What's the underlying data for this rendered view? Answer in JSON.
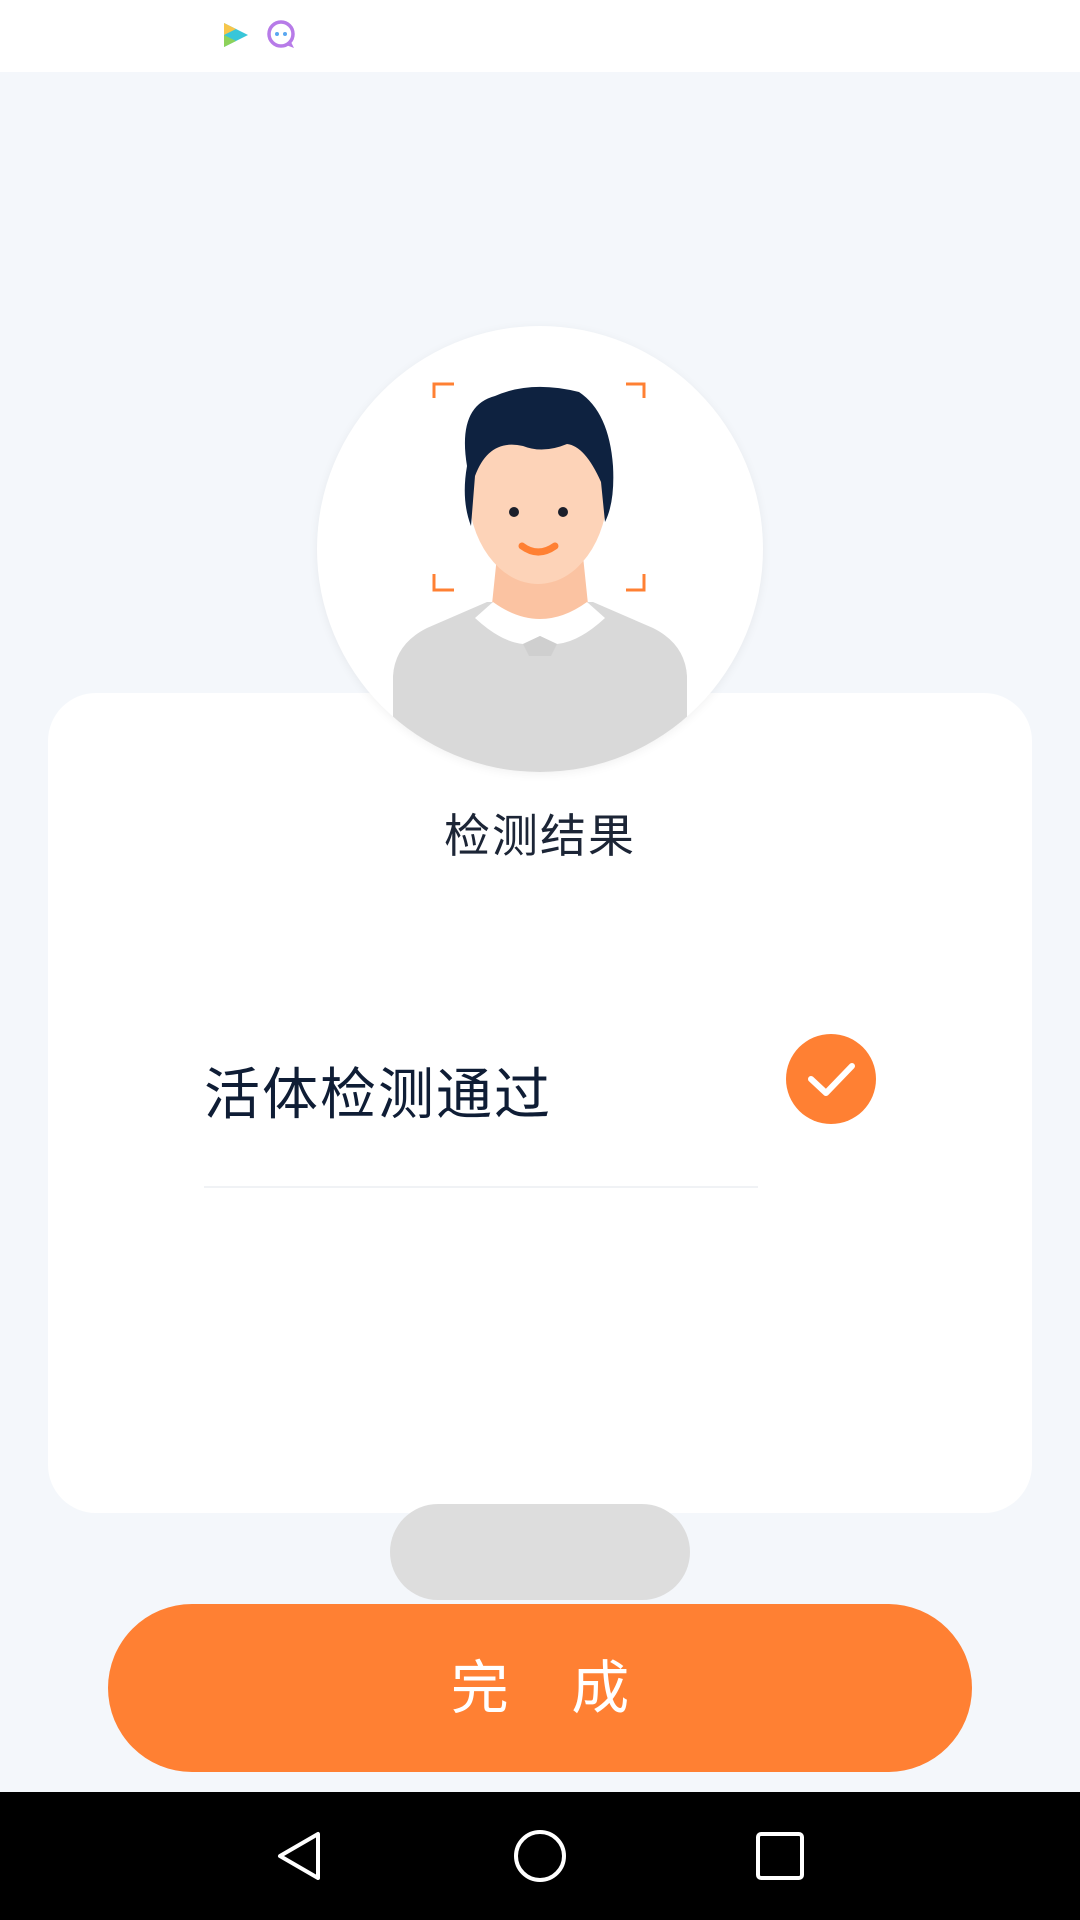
{
  "result": {
    "title": "检测结果",
    "status_label": "活体检测通过",
    "status_icon": "check-icon"
  },
  "actions": {
    "done_label": "完 成"
  },
  "colors": {
    "accent": "#ff8033",
    "background": "#f4f7fb",
    "text_primary": "#0f1d35",
    "hair": "#0e2240",
    "skin": "#fdd3b8",
    "shirt": "#d9d9d9"
  },
  "status_bar_icons": [
    "video-app-icon",
    "chat-app-icon"
  ],
  "nav_bar_icons": [
    "back-icon",
    "home-icon",
    "recents-icon"
  ]
}
